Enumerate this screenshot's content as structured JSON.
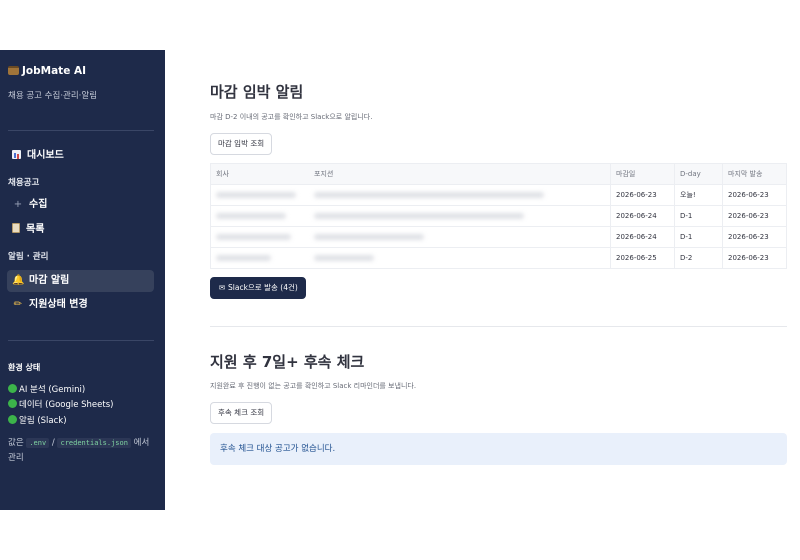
{
  "sidebar": {
    "brand": "JobMate AI",
    "tagline": "채용 공고 수집·관리·알림",
    "nav": {
      "dashboard": "대시보드",
      "section_jobs": "채용공고",
      "collect": "수집",
      "list": "목록",
      "section_alerts": "알림 · 관리",
      "deadline_alert": "마감 알림",
      "status_change": "지원상태 변경"
    },
    "env": {
      "title": "환경 상태",
      "items": [
        "AI 분석 (Gemini)",
        "데이터 (Google Sheets)",
        "알림 (Slack)"
      ],
      "status_color": "#3cb44a"
    },
    "note": {
      "prefix": "값은",
      "file1": ".env",
      "slash": "/",
      "file2": "credentials.json",
      "suffix": "에서 관리"
    }
  },
  "deadline": {
    "title": "마감 임박 알림",
    "caption": "마감 D-2 이내의 공고를 확인하고 Slack으로 알립니다.",
    "query_button": "마감 임박 조회",
    "columns": [
      "회사",
      "포지션",
      "마감일",
      "D-day",
      "마지막 발송"
    ],
    "rows": [
      {
        "deadline": "2026-06-23",
        "dday": "오늘!",
        "last_sent": "2026-06-23"
      },
      {
        "deadline": "2026-06-24",
        "dday": "D-1",
        "last_sent": "2026-06-23"
      },
      {
        "deadline": "2026-06-24",
        "dday": "D-1",
        "last_sent": "2026-06-23"
      },
      {
        "deadline": "2026-06-25",
        "dday": "D-2",
        "last_sent": "2026-06-23"
      }
    ],
    "send_button": "Slack으로 발송 (4건)"
  },
  "followup": {
    "title": "지원 후 7일+ 후속 체크",
    "caption": "지원완료 후 진행이 없는 공고를 확인하고 Slack 리마인더를 보냅니다.",
    "query_button": "후속 체크 조회",
    "info": "후속 체크 대상 공고가 없습니다."
  },
  "colors": {
    "sidebar_bg": "#1e2a4a",
    "active_item": "#36415c",
    "info_bg": "#e9f0fb"
  }
}
